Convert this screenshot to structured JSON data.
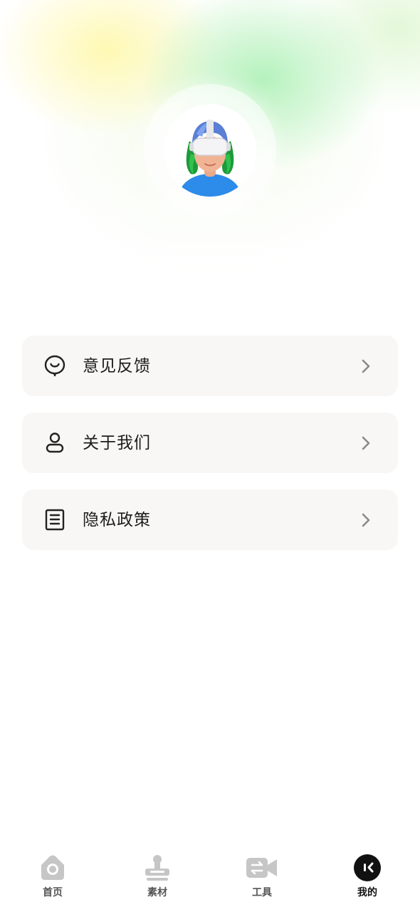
{
  "profile": {
    "avatar_icon": "vr-headset-avatar"
  },
  "menu": {
    "items": [
      {
        "label": "意见反馈",
        "icon": "feedback-icon"
      },
      {
        "label": "关于我们",
        "icon": "user-icon"
      },
      {
        "label": "隐私政策",
        "icon": "document-icon"
      }
    ]
  },
  "tabbar": {
    "items": [
      {
        "label": "首页",
        "icon": "home-icon",
        "active": false
      },
      {
        "label": "素材",
        "icon": "stamp-icon",
        "active": false
      },
      {
        "label": "工具",
        "icon": "video-camera-icon",
        "active": false
      },
      {
        "label": "我的",
        "icon": "profile-face-icon",
        "active": true
      }
    ]
  },
  "colors": {
    "menu_background": "#f8f7f6",
    "tab_inactive_icon": "#c6c6c6",
    "tab_active_icon": "#111111",
    "avatar_shirt": "#2d8bea"
  }
}
